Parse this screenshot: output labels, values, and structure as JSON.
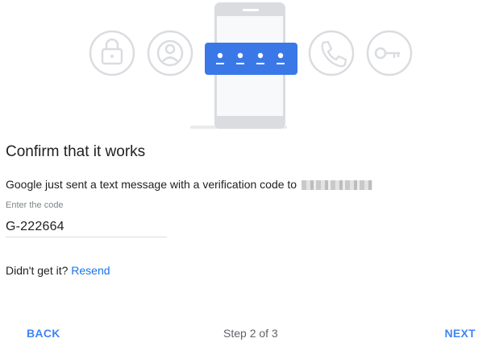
{
  "illustration": {
    "icons": [
      "lock-icon",
      "account-icon",
      "phone-call-icon",
      "key-icon"
    ],
    "phone_icon": "smartphone-icon",
    "password_dots": 4,
    "colors": {
      "accent": "#3b78e7",
      "circle_stroke": "#dadce0",
      "phone_body": "#f1f3f4",
      "phone_frame": "#dadce0"
    }
  },
  "content": {
    "title": "Confirm that it works",
    "message": "Google just sent a text message with a verification code to",
    "phone_number_redacted": true,
    "field_label": "Enter the code",
    "code_value": "G-222664",
    "resend_prompt": "Didn't get it?",
    "resend_link": "Resend"
  },
  "footer": {
    "back_label": "BACK",
    "step_text": "Step 2 of 3",
    "next_label": "NEXT"
  },
  "colors": {
    "link": "#1a73e8",
    "button": "#4285f4",
    "text": "#202124",
    "muted": "#5f6368"
  }
}
